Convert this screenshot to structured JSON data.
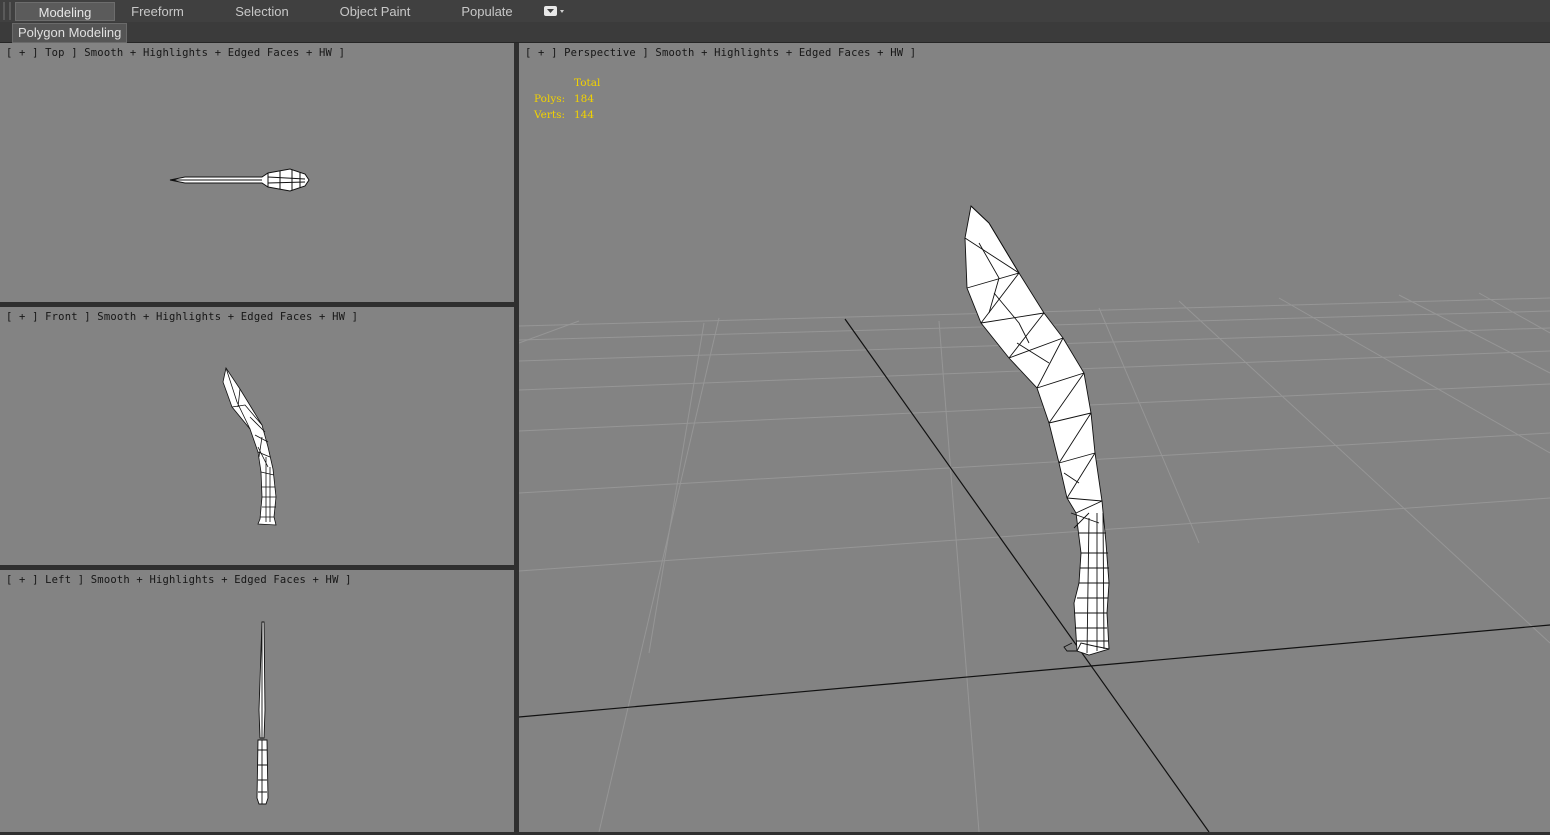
{
  "ribbon": {
    "tabs": [
      "Modeling",
      "Freeform",
      "Selection",
      "Object Paint",
      "Populate"
    ],
    "active_tab": "Modeling",
    "subtab": "Polygon Modeling",
    "dropdown_icon": "dropdown-toggle-icon"
  },
  "viewports": {
    "top": {
      "label": "[ + ] Top ] Smooth + Highlights + Edged Faces + HW ]"
    },
    "front": {
      "label": "[ + ] Front ] Smooth + Highlights + Edged Faces + HW ]"
    },
    "left": {
      "label": "[ + ] Left ] Smooth + Highlights + Edged Faces + HW ]"
    },
    "perspective": {
      "label": "[ + ] Perspective ] Smooth + Highlights + Edged Faces + HW ]",
      "stats": {
        "header": "Total",
        "polys_label": "Polys:",
        "polys": "184",
        "verts_label": "Verts:",
        "verts": "144"
      }
    }
  },
  "colors": {
    "viewport_bg": "#838383",
    "stats_text": "#f2d200",
    "ui_bg": "#404040"
  }
}
